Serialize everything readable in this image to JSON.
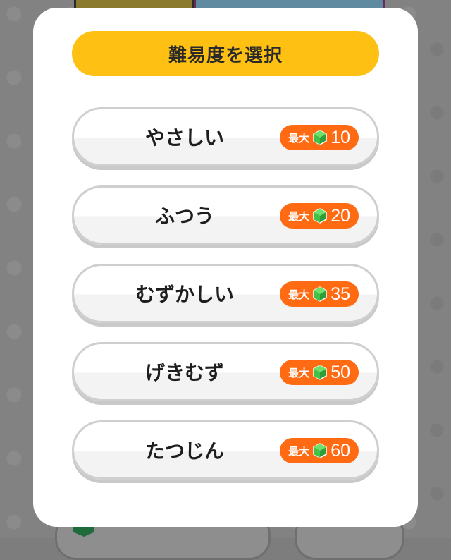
{
  "title": "難易度を選択",
  "difficulties": [
    {
      "label": "やさしい",
      "reward_prefix": "最大",
      "reward_value": "10"
    },
    {
      "label": "ふつう",
      "reward_prefix": "最大",
      "reward_value": "20"
    },
    {
      "label": "むずかしい",
      "reward_prefix": "最大",
      "reward_value": "35"
    },
    {
      "label": "げきむず",
      "reward_prefix": "最大",
      "reward_value": "50"
    },
    {
      "label": "たつじん",
      "reward_prefix": "最大",
      "reward_value": "60"
    }
  ],
  "icons": {
    "reward": "green-gem-icon"
  },
  "colors": {
    "title_bar": "#fdc013",
    "badge": "#ff6a13",
    "gem": "#3cc24a",
    "overlay": "#828282"
  }
}
